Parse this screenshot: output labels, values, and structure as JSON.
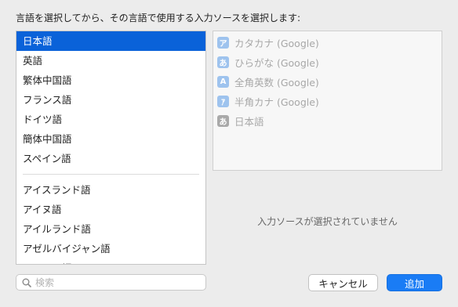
{
  "prompt": "言語を選択してから、その言語で使用する入力ソースを選択します:",
  "languages_group1": [
    {
      "label": "日本語",
      "selected": true
    },
    {
      "label": "英語"
    },
    {
      "label": "繁体中国語"
    },
    {
      "label": "フランス語"
    },
    {
      "label": "ドイツ語"
    },
    {
      "label": "簡体中国語"
    },
    {
      "label": "スペイン語"
    }
  ],
  "languages_group2": [
    {
      "label": "アイスランド語"
    },
    {
      "label": "アイヌ語"
    },
    {
      "label": "アイルランド語"
    },
    {
      "label": "アゼルバイジャン語"
    },
    {
      "label": "アッサム語"
    }
  ],
  "input_sources": [
    {
      "icon_text": "ア",
      "icon": "katakana-icon",
      "label": "カタカナ (Google)"
    },
    {
      "icon_text": "あ",
      "icon": "hiragana-icon",
      "label": "ひらがな (Google)"
    },
    {
      "icon_text": "A",
      "icon": "alphanumeric-icon",
      "label": "全角英数 (Google)"
    },
    {
      "icon_text": "ｱ",
      "icon": "halfwidth-katakana-icon",
      "label": "半角カナ (Google)"
    },
    {
      "icon_text": "あ",
      "icon": "japanese-icon",
      "label": "日本語"
    }
  ],
  "empty_message": "入力ソースが選択されていません",
  "search": {
    "placeholder": "検索",
    "value": ""
  },
  "buttons": {
    "cancel": "キャンセル",
    "add": "追加"
  },
  "colors": {
    "selection": "#0a62d9",
    "primary_button": "#1a7cf5",
    "source_icon": "#9ec3ee"
  }
}
